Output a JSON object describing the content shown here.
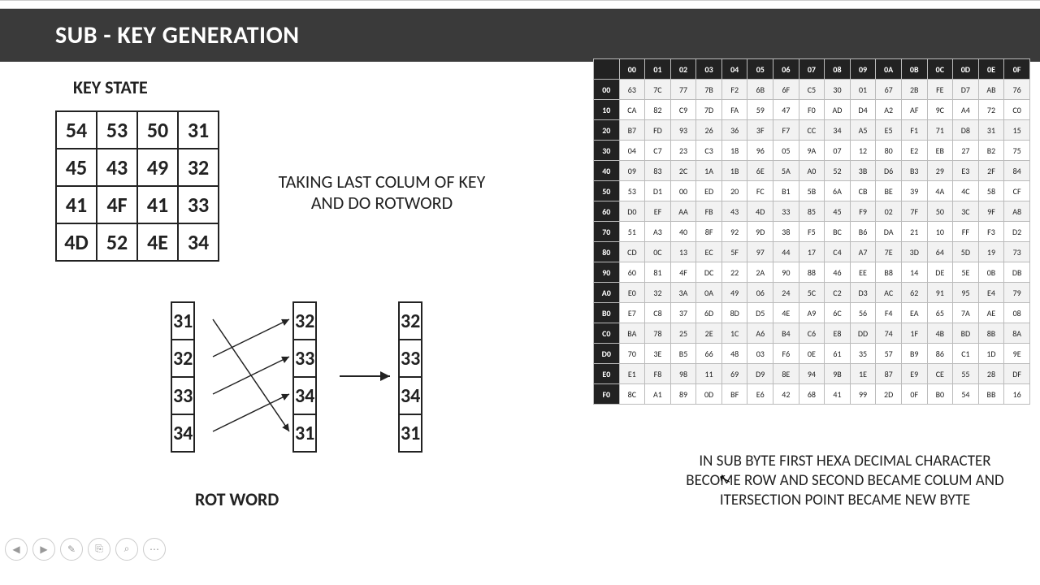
{
  "title": "SUB - KEY GENERATION",
  "labels": {
    "key_state": "KEY STATE",
    "rot_word": "ROT WORD"
  },
  "key_state": [
    [
      "54",
      "53",
      "50",
      "31"
    ],
    [
      "45",
      "43",
      "49",
      "32"
    ],
    [
      "41",
      "4F",
      "41",
      "33"
    ],
    [
      "4D",
      "52",
      "4E",
      "34"
    ]
  ],
  "right_text": "TAKING LAST COLUM OF KEY AND DO ROTWORD",
  "rot": {
    "src": [
      "31",
      "32",
      "33",
      "34"
    ],
    "permuted": [
      "32",
      "33",
      "34",
      "31"
    ],
    "result": [
      "32",
      "33",
      "34",
      "31"
    ]
  },
  "sbox": {
    "col_headers": [
      "00",
      "01",
      "02",
      "03",
      "04",
      "05",
      "06",
      "07",
      "08",
      "09",
      "0A",
      "0B",
      "0C",
      "0D",
      "0E",
      "0F"
    ],
    "row_headers": [
      "00",
      "10",
      "20",
      "30",
      "40",
      "50",
      "60",
      "70",
      "80",
      "90",
      "A0",
      "B0",
      "C0",
      "D0",
      "E0",
      "F0"
    ],
    "rows": [
      [
        "63",
        "7C",
        "77",
        "7B",
        "F2",
        "6B",
        "6F",
        "C5",
        "30",
        "01",
        "67",
        "2B",
        "FE",
        "D7",
        "AB",
        "76"
      ],
      [
        "CA",
        "82",
        "C9",
        "7D",
        "FA",
        "59",
        "47",
        "F0",
        "AD",
        "D4",
        "A2",
        "AF",
        "9C",
        "A4",
        "72",
        "C0"
      ],
      [
        "B7",
        "FD",
        "93",
        "26",
        "36",
        "3F",
        "F7",
        "CC",
        "34",
        "A5",
        "E5",
        "F1",
        "71",
        "D8",
        "31",
        "15"
      ],
      [
        "04",
        "C7",
        "23",
        "C3",
        "18",
        "96",
        "05",
        "9A",
        "07",
        "12",
        "80",
        "E2",
        "EB",
        "27",
        "B2",
        "75"
      ],
      [
        "09",
        "83",
        "2C",
        "1A",
        "1B",
        "6E",
        "5A",
        "A0",
        "52",
        "3B",
        "D6",
        "B3",
        "29",
        "E3",
        "2F",
        "84"
      ],
      [
        "53",
        "D1",
        "00",
        "ED",
        "20",
        "FC",
        "B1",
        "5B",
        "6A",
        "CB",
        "BE",
        "39",
        "4A",
        "4C",
        "58",
        "CF"
      ],
      [
        "D0",
        "EF",
        "AA",
        "FB",
        "43",
        "4D",
        "33",
        "85",
        "45",
        "F9",
        "02",
        "7F",
        "50",
        "3C",
        "9F",
        "A8"
      ],
      [
        "51",
        "A3",
        "40",
        "8F",
        "92",
        "9D",
        "38",
        "F5",
        "BC",
        "B6",
        "DA",
        "21",
        "10",
        "FF",
        "F3",
        "D2"
      ],
      [
        "CD",
        "0C",
        "13",
        "EC",
        "5F",
        "97",
        "44",
        "17",
        "C4",
        "A7",
        "7E",
        "3D",
        "64",
        "5D",
        "19",
        "73"
      ],
      [
        "60",
        "81",
        "4F",
        "DC",
        "22",
        "2A",
        "90",
        "88",
        "46",
        "EE",
        "B8",
        "14",
        "DE",
        "5E",
        "0B",
        "DB"
      ],
      [
        "E0",
        "32",
        "3A",
        "0A",
        "49",
        "06",
        "24",
        "5C",
        "C2",
        "D3",
        "AC",
        "62",
        "91",
        "95",
        "E4",
        "79"
      ],
      [
        "E7",
        "C8",
        "37",
        "6D",
        "8D",
        "D5",
        "4E",
        "A9",
        "6C",
        "56",
        "F4",
        "EA",
        "65",
        "7A",
        "AE",
        "08"
      ],
      [
        "BA",
        "78",
        "25",
        "2E",
        "1C",
        "A6",
        "B4",
        "C6",
        "E8",
        "DD",
        "74",
        "1F",
        "4B",
        "BD",
        "8B",
        "8A"
      ],
      [
        "70",
        "3E",
        "B5",
        "66",
        "48",
        "03",
        "F6",
        "0E",
        "61",
        "35",
        "57",
        "B9",
        "86",
        "C1",
        "1D",
        "9E"
      ],
      [
        "E1",
        "F8",
        "98",
        "11",
        "69",
        "D9",
        "8E",
        "94",
        "9B",
        "1E",
        "87",
        "E9",
        "CE",
        "55",
        "28",
        "DF"
      ],
      [
        "8C",
        "A1",
        "89",
        "0D",
        "BF",
        "E6",
        "42",
        "68",
        "41",
        "99",
        "2D",
        "0F",
        "B0",
        "54",
        "BB",
        "16"
      ]
    ]
  },
  "bottom_text": "IN SUB BYTE FIRST HEXA DECIMAL CHARACTER BECOME ROW AND SECOND BECAME  COLUM AND  ITERSECTION POINT BECAME NEW BYTE",
  "controls": {
    "prev": "◀",
    "next": "▶",
    "pen": "✎",
    "clip": "⎘",
    "zoom": "⌕",
    "more": "⋯"
  }
}
